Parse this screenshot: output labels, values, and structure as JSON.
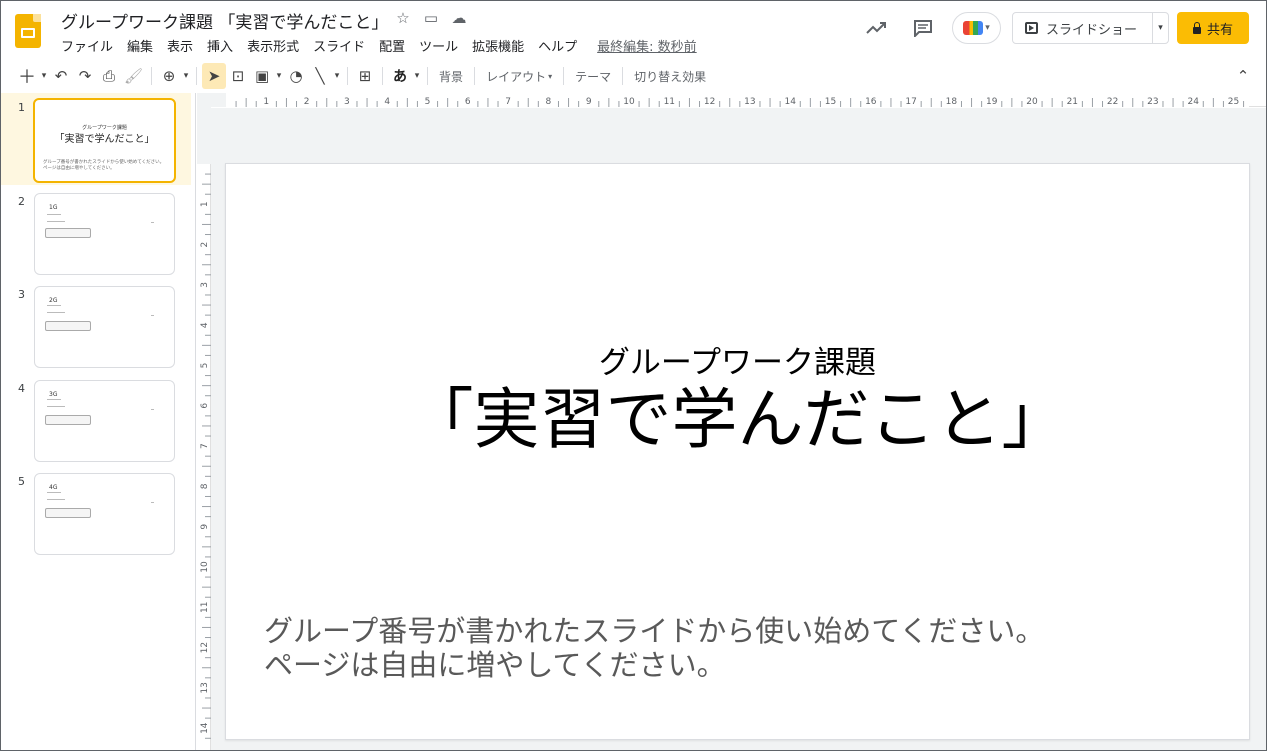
{
  "header": {
    "doc_title": "グループワーク課題 「実習で学んだこと」",
    "menus": [
      "ファイル",
      "編集",
      "表示",
      "挿入",
      "表示形式",
      "スライド",
      "配置",
      "ツール",
      "拡張機能",
      "ヘルプ"
    ],
    "last_edit": "最終編集: 数秒前",
    "slideshow_label": "スライドショー",
    "share_label": "共有"
  },
  "toolbar": {
    "background_label": "背景",
    "layout_label": "レイアウト",
    "theme_label": "テーマ",
    "transition_label": "切り替え効果",
    "input_mode_label": "あ"
  },
  "slides_panel": {
    "thumbs": [
      {
        "num": "1",
        "subtitle": "グループワーク課題",
        "title": "「実習で学んだこと」",
        "body": "グループ番号が書かれたスライドから使い始めてください。ページは自由に増やしてください。"
      },
      {
        "num": "2",
        "heading": "1G"
      },
      {
        "num": "3",
        "heading": "2G"
      },
      {
        "num": "4",
        "heading": "3G"
      },
      {
        "num": "5",
        "heading": "4G"
      }
    ]
  },
  "ruler": {
    "h_ticks": [
      "1",
      "2",
      "3",
      "4",
      "5",
      "6",
      "7",
      "8",
      "9",
      "10",
      "11",
      "12",
      "13",
      "14",
      "15",
      "16",
      "17",
      "18",
      "19",
      "20",
      "21",
      "22",
      "23",
      "24",
      "25"
    ],
    "v_ticks": [
      "1",
      "2",
      "3",
      "4",
      "5",
      "6",
      "7",
      "8",
      "9",
      "10",
      "11",
      "12",
      "13",
      "14"
    ]
  },
  "slide": {
    "subtitle": "グループワーク課題",
    "title": "「実習で学んだこと」",
    "body_line1": "グループ番号が書かれたスライドから使い始めてください。",
    "body_line2": "ページは自由に増やしてください。"
  },
  "colors": {
    "accent": "#f4b400",
    "share_button": "#fbbc04",
    "selected_thumb_bg": "#fef7e0",
    "canvas_bg": "#f1f3f4"
  },
  "icons": [
    "trending-icon",
    "comment-icon",
    "meet-icon",
    "star-icon",
    "move-folder-icon",
    "cloud-saved-icon"
  ]
}
